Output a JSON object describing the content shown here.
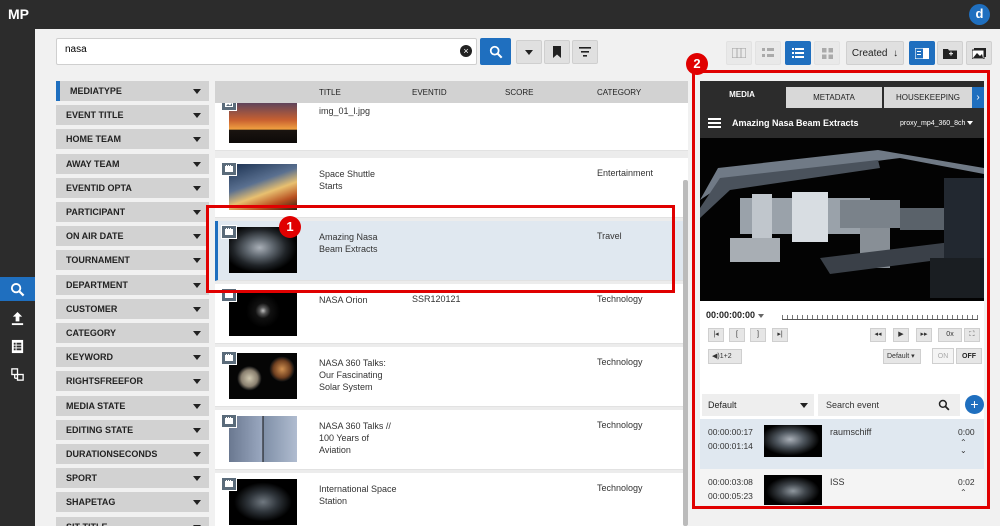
{
  "app": {
    "title": "MP",
    "user_initial": "d"
  },
  "nav": {
    "items": [
      {
        "name": "search-icon",
        "active": true
      },
      {
        "name": "upload-icon",
        "active": false
      },
      {
        "name": "list-icon",
        "active": false
      },
      {
        "name": "workflow-icon",
        "active": false
      }
    ]
  },
  "search": {
    "value": "nasa"
  },
  "toolbar": {
    "sort_label": "Created",
    "sort_direction": "↓"
  },
  "facets": [
    "MEDIATYPE",
    "EVENT TITLE",
    "HOME TEAM",
    "AWAY TEAM",
    "EVENTID OPTA",
    "PARTICIPANT",
    "ON AIR DATE",
    "TOURNAMENT",
    "DEPARTMENT",
    "CUSTOMER",
    "CATEGORY",
    "KEYWORD",
    "RIGHTSFREEFOR",
    "MEDIA STATE",
    "EDITING STATE",
    "DURATIONSECONDS",
    "SPORT",
    "SHAPETAG",
    "SIT TITLE"
  ],
  "results": {
    "columns": {
      "title": "TITLE",
      "eventid": "EVENTID",
      "score": "SCORE",
      "category": "CATEGORY"
    },
    "rows": [
      {
        "title": "img_01_l.jpg",
        "eventid": "",
        "category": "",
        "type": "image"
      },
      {
        "title": "Space Shuttle Starts",
        "eventid": "",
        "category": "Entertainment",
        "type": "video"
      },
      {
        "title": "Amazing Nasa Beam Extracts",
        "eventid": "",
        "category": "Travel",
        "type": "video",
        "selected": true
      },
      {
        "title": "NASA Orion",
        "eventid": "SSR120121",
        "category": "Technology",
        "type": "video"
      },
      {
        "title": "NASA 360 Talks: Our Fascinating Solar System",
        "eventid": "",
        "category": "Technology",
        "type": "video"
      },
      {
        "title": "NASA 360 Talks // 100 Years of Aviation",
        "eventid": "",
        "category": "Technology",
        "type": "video"
      },
      {
        "title": "International Space Station",
        "eventid": "",
        "category": "Technology",
        "type": "video"
      }
    ]
  },
  "annotations": {
    "one": "1",
    "two": "2"
  },
  "preview": {
    "tabs": [
      "MEDIA",
      "METADATA",
      "HOUSEKEEPING"
    ],
    "title": "Amazing Nasa Beam Extracts",
    "format": "proxy_mp4_360_8ch",
    "timecode": "00:00:00:00",
    "controls": {
      "speed": "0x",
      "audio": "1+2",
      "audio_preset": "Default",
      "toggle_on": "ON",
      "toggle_off": "OFF"
    },
    "events": {
      "filter": "Default",
      "search_placeholder": "Search event",
      "items": [
        {
          "in": "00:00:00:17",
          "out": "00:00:01:14",
          "name": "raumschiff",
          "duration": "0:00"
        },
        {
          "in": "00:00:03:08",
          "out": "00:00:05:23",
          "name": "ISS",
          "duration": "0:02"
        }
      ]
    }
  },
  "colors": {
    "accent": "#1f6fbf",
    "topbar": "#2c2c2c",
    "highlight": "#e00000"
  }
}
